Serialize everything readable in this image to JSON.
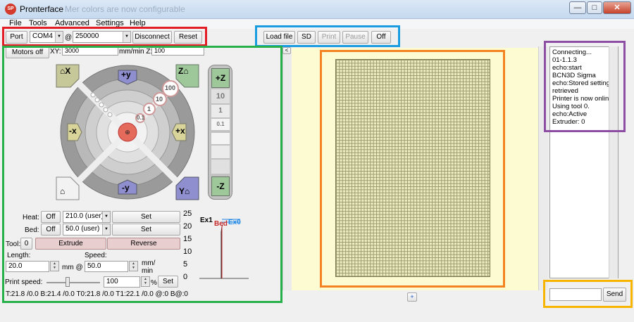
{
  "window": {
    "title": "Pronterface",
    "ghost_text": "Mer colors are now configurable",
    "icon": "pronterface-logo-icon",
    "icon_text": "SP",
    "min_label": "—",
    "max_label": "□",
    "close_label": "✕"
  },
  "menu": [
    "File",
    "Tools",
    "Advanced",
    "Settings",
    "Help"
  ],
  "connection": {
    "port_label": "Port",
    "port_value": "COM4",
    "baud_value": "250000",
    "at": "@",
    "disconnect_label": "Disconnect",
    "reset_label": "Reset"
  },
  "file_toolbar": {
    "load_label": "Load file",
    "sd_label": "SD",
    "print_label": "Print",
    "pause_label": "Pause",
    "off_label": "Off"
  },
  "motion": {
    "motors_off_label": "Motors off",
    "xy_label": "XY:",
    "xy_value": "3000",
    "mm_min_z_label": "mm/min Z:",
    "z_value": "100",
    "home_x": "X",
    "home_z": "Z",
    "home_y": "Y",
    "plus_y": "+y",
    "minus_y": "-y",
    "plus_x": "+x",
    "minus_x": "-x",
    "step_100": "100",
    "step_10": "10",
    "step_1": "1",
    "step_01": "0.1",
    "z_plus": "+Z",
    "z_minus": "-Z",
    "z_10": "10",
    "z_1": "1",
    "z_01": "0.1",
    "center_label": "X\nY"
  },
  "temperature": {
    "heat_label": "Heat:",
    "heat_off": "Off",
    "heat_value": "210.0 (user)",
    "heat_set": "Set",
    "bed_label": "Bed:",
    "bed_off": "Off",
    "bed_value": "50.0 (user)",
    "bed_set": "Set",
    "tool_label": "Tool:",
    "tool_value": "0",
    "extrude_label": "Extrude",
    "reverse_label": "Reverse",
    "length_label": "Length:",
    "length_value": "20.0",
    "length_unit": "mm @",
    "speed_label": "Speed:",
    "speed_value": "50.0",
    "speed_unit": "mm/\nmin",
    "print_speed_label": "Print speed:",
    "print_speed_value": "100",
    "percent": "%",
    "print_speed_set": "Set",
    "status_line": "T:21.8 /0.0 B:21.4 /0.0 T0:21.8 /0.0 T1:22.1 /0.0 @:0 B@:0"
  },
  "temp_graph": {
    "y_ticks": [
      "25",
      "20",
      "15",
      "10",
      "5",
      "0"
    ],
    "legend_ex1": "Ex1",
    "legend_bed": "Bed",
    "legend_ex0": "Ex0",
    "color_ex1": "#2a2a2a",
    "color_bed": "#c62828",
    "color_ex0": "#1e88e5"
  },
  "preview": {
    "plus_label": "+",
    "collapse_label": "<"
  },
  "console": {
    "lines": [
      "Connecting...",
      "01-1.1.3",
      "echo:start",
      "BCN3D Sigma",
      "echo:Stored settings",
      "retrieved",
      "Printer is now online.",
      "Using tool 0.",
      "echo:Active",
      "Extruder: 0"
    ],
    "send_label": "Send",
    "command_value": ""
  },
  "annotation_colors": {
    "connection": "#e31d25",
    "file": "#1a9de0",
    "controls": "#27b04a",
    "preview": "#f58220",
    "log": "#8e4da4",
    "send": "#f7b500"
  }
}
